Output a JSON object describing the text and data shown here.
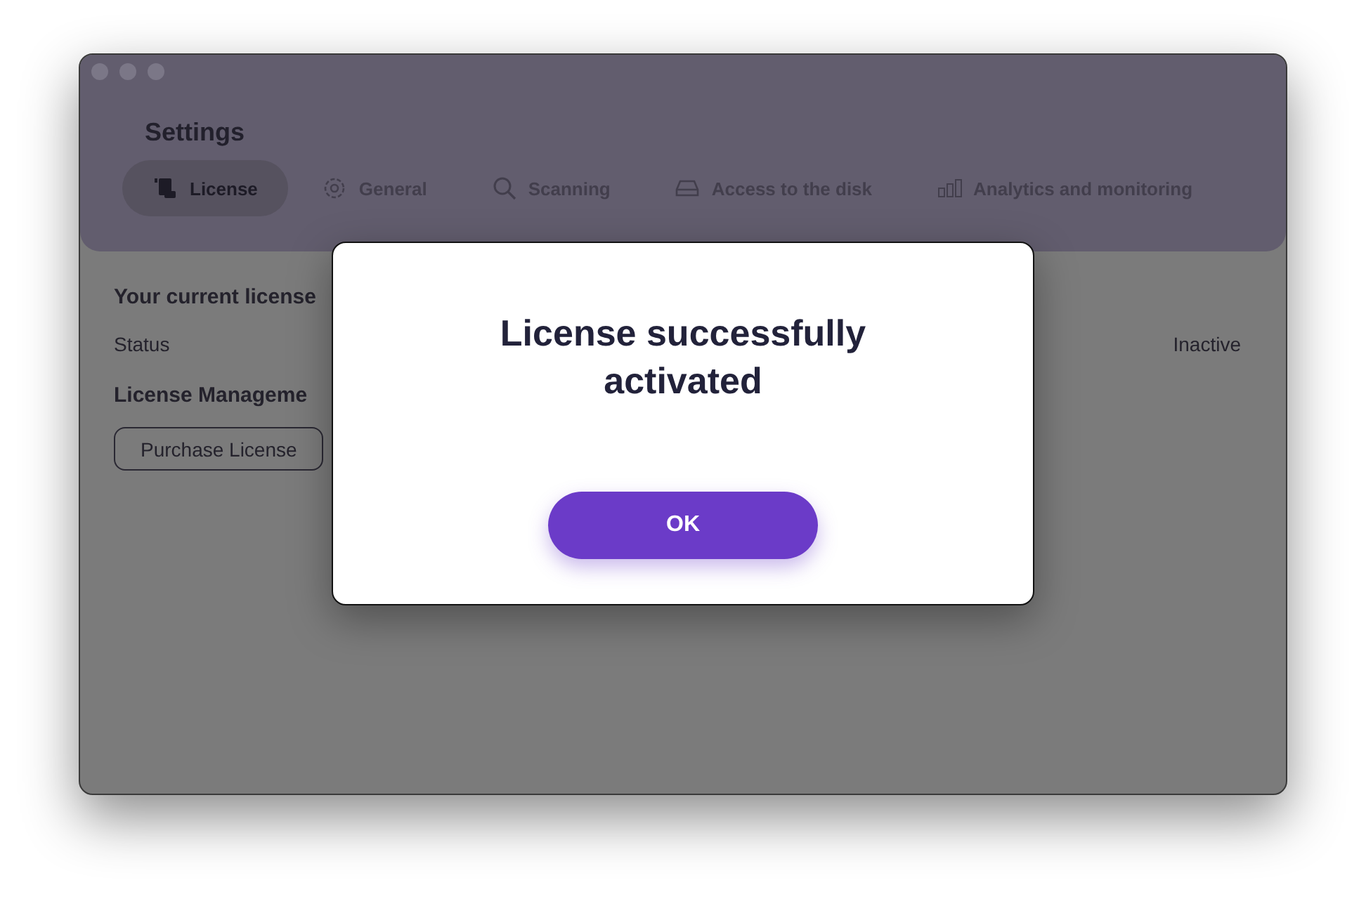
{
  "window": {
    "title": "Settings"
  },
  "tabs": [
    {
      "label": "License",
      "selected": true
    },
    {
      "label": "General",
      "selected": false
    },
    {
      "label": "Scanning",
      "selected": false
    },
    {
      "label": "Access to the disk",
      "selected": false
    },
    {
      "label": "Analytics and monitoring",
      "selected": false
    }
  ],
  "license": {
    "heading": "Your current license",
    "status_label": "Status",
    "status_value": "Inactive",
    "management_heading": "License Manageme",
    "purchase_button": "Purchase License"
  },
  "dialog": {
    "title": "License successfully activated",
    "button": "OK"
  }
}
